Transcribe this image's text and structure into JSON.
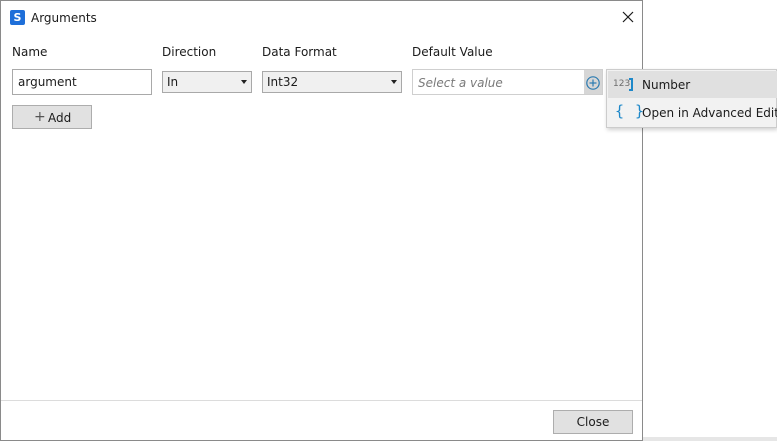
{
  "dialog": {
    "title": "Arguments",
    "app_icon": "uipath-studio-icon",
    "close_icon": "close-icon"
  },
  "columns": {
    "name": "Name",
    "direction": "Direction",
    "data_format": "Data Format",
    "default_value": "Default Value"
  },
  "row": {
    "name_value": "argument",
    "direction_value": "In",
    "data_format_value": "Int32",
    "default_value_placeholder": "Select a value"
  },
  "buttons": {
    "add_label": "Add",
    "close_label": "Close"
  },
  "menu": {
    "items": [
      {
        "label": "Number",
        "icon": "number-123-icon"
      },
      {
        "label": "Open in Advanced Editor",
        "icon": "curly-braces-icon"
      }
    ]
  },
  "colors": {
    "accent": "#1e88c9",
    "menu_highlight": "#e0e0e0"
  }
}
